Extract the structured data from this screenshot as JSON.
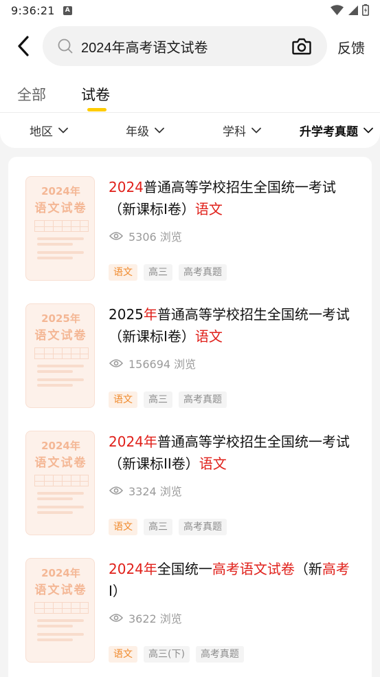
{
  "status_bar": {
    "time": "9:36:21",
    "notification_letter": "A"
  },
  "search": {
    "query": "2024年高考语文试卷",
    "feedback_label": "反馈"
  },
  "tabs": [
    {
      "label": "全部",
      "active": false
    },
    {
      "label": "试卷",
      "active": true
    }
  ],
  "filters": [
    {
      "label": "地区",
      "bold": false
    },
    {
      "label": "年级",
      "bold": false
    },
    {
      "label": "学科",
      "bold": false
    },
    {
      "label": "升学考真题",
      "bold": true
    }
  ],
  "colors": {
    "accent_yellow": "#ffcc00",
    "highlight_red": "#e0201a",
    "tag_orange": "#f08a2c",
    "thumb_bg": "#fdf1ea"
  },
  "results": [
    {
      "thumb_year": "2024年",
      "thumb_subject": "语文试卷",
      "title_segments": [
        {
          "text": "2024",
          "hl": true
        },
        {
          "text": "普通高等学校招生全国统一考试（新课标I卷）",
          "hl": false
        },
        {
          "text": "语文",
          "hl": true
        }
      ],
      "views": "5306 浏览",
      "tags": [
        "语文",
        "高三",
        "高考真题"
      ]
    },
    {
      "thumb_year": "2025年",
      "thumb_subject": "语文试卷",
      "title_segments": [
        {
          "text": "2025",
          "hl": false
        },
        {
          "text": "年",
          "hl": true
        },
        {
          "text": "普通高等学校招生全国统一考试（新课标I卷）",
          "hl": false
        },
        {
          "text": "语文",
          "hl": true
        }
      ],
      "views": "156694 浏览",
      "tags": [
        "语文",
        "高三",
        "高考真题"
      ]
    },
    {
      "thumb_year": "2024年",
      "thumb_subject": "语文试卷",
      "title_segments": [
        {
          "text": "2024年",
          "hl": true
        },
        {
          "text": "普通高等学校招生全国统一考试（新课标II卷）",
          "hl": false
        },
        {
          "text": "语文",
          "hl": true
        }
      ],
      "views": "3324 浏览",
      "tags": [
        "语文",
        "高三",
        "高考真题"
      ]
    },
    {
      "thumb_year": "2024年",
      "thumb_subject": "语文试卷",
      "title_segments": [
        {
          "text": "2024年",
          "hl": true
        },
        {
          "text": "全国统一",
          "hl": false
        },
        {
          "text": "高考语文试卷",
          "hl": true
        },
        {
          "text": "（新",
          "hl": false
        },
        {
          "text": "高考",
          "hl": true
        },
        {
          "text": "I）",
          "hl": false
        }
      ],
      "views": "3622 浏览",
      "tags": [
        "语文",
        "高三(下)",
        "高考真题"
      ]
    }
  ]
}
